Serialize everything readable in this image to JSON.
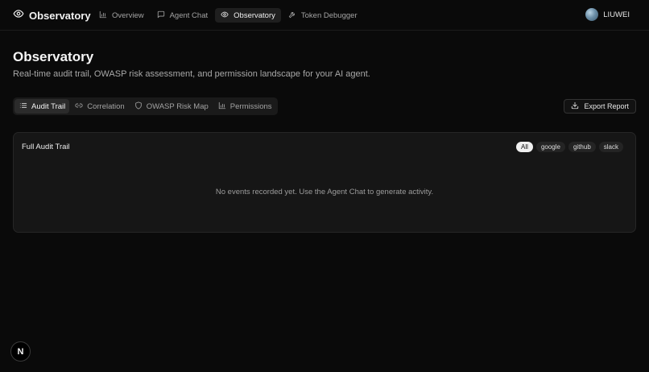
{
  "brand": {
    "name": "Observatory",
    "icon": "eye-icon"
  },
  "nav": {
    "items": [
      {
        "label": "Overview",
        "icon": "bar-chart-icon",
        "active": false
      },
      {
        "label": "Agent Chat",
        "icon": "message-square-icon",
        "active": false
      },
      {
        "label": "Observatory",
        "icon": "eye-icon",
        "active": true
      },
      {
        "label": "Token Debugger",
        "icon": "wrench-icon",
        "active": false
      }
    ]
  },
  "user": {
    "name": "LIUWEI"
  },
  "page": {
    "title": "Observatory",
    "subtitle": "Real-time audit trail, OWASP risk assessment, and permission landscape for your AI agent."
  },
  "tabs": [
    {
      "label": "Audit Trail",
      "icon": "list-icon",
      "active": true
    },
    {
      "label": "Correlation",
      "icon": "link-icon",
      "active": false
    },
    {
      "label": "OWASP Risk Map",
      "icon": "shield-icon",
      "active": false
    },
    {
      "label": "Permissions",
      "icon": "bar-chart-icon",
      "active": false
    }
  ],
  "export": {
    "label": "Export Report",
    "icon": "download-icon"
  },
  "audit": {
    "title": "Full Audit Trail",
    "filters": [
      "All",
      "google",
      "github",
      "slack"
    ],
    "active_filter": "All",
    "empty_message": "No events recorded yet. Use the Agent Chat to generate activity."
  },
  "badge": {
    "letter": "N"
  },
  "colors": {
    "background": "#0a0a0a",
    "card": "#161616",
    "active_chip": "#f0f0f0"
  }
}
